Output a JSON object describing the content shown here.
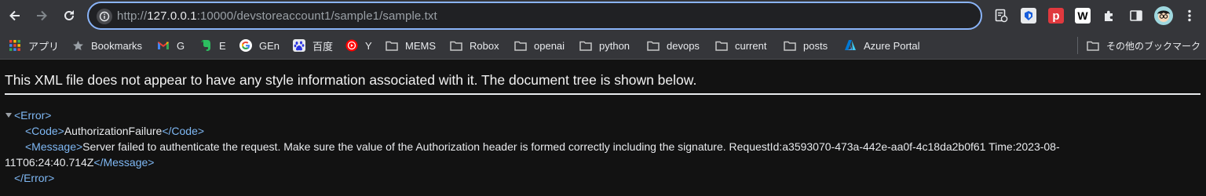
{
  "browser": {
    "url_scheme": "http://",
    "url_host": "127.0.0.1",
    "url_rest": ":10000/devstoreaccount1/sample1/sample.txt"
  },
  "toolbar_icons": [
    "back-arrow-icon",
    "forward-arrow-icon",
    "reload-icon",
    "site-info-icon",
    "reading-list-icon",
    "bitwarden-icon",
    "pocket-icon",
    "w-extension-icon",
    "puzzle-icon",
    "side-panel-icon",
    "avatar",
    "kebab-menu-icon"
  ],
  "extensions": {
    "w_label": "W",
    "p_label": "p"
  },
  "bookmarks": {
    "apps": "アプリ",
    "bookmarks": "Bookmarks",
    "gmail": "G",
    "evernote": "E",
    "google": "GEn",
    "baidu": "百度",
    "youtube": "Y",
    "mems": "MEMS",
    "robox": "Robox",
    "openai": "openai",
    "python": "python",
    "devops": "devops",
    "current": "current",
    "posts": "posts",
    "azure": "Azure Portal",
    "other": "その他のブックマーク"
  },
  "colors": {
    "accent": "#8ab4f8",
    "xml_tag": "#7fb8f4",
    "background": "#121212",
    "toolbar": "#35363a"
  },
  "page": {
    "notice": "This XML file does not appear to have any style information associated with it. The document tree is shown below.",
    "error_open": "<Error>",
    "code_open": "<Code>",
    "code_value": "AuthorizationFailure",
    "code_close": "</Code>",
    "message_open": "<Message>",
    "message_line1": "Server failed to authenticate the request. Make sure the value of the Authorization header is formed correctly including the signature. RequestId:a3593070-473a-442e-aa0f-4c18da2b0f61 Time:2023-08-",
    "message_line2": "11T06:24:40.714Z",
    "message_close": "</Message>",
    "error_close": "</Error>"
  }
}
